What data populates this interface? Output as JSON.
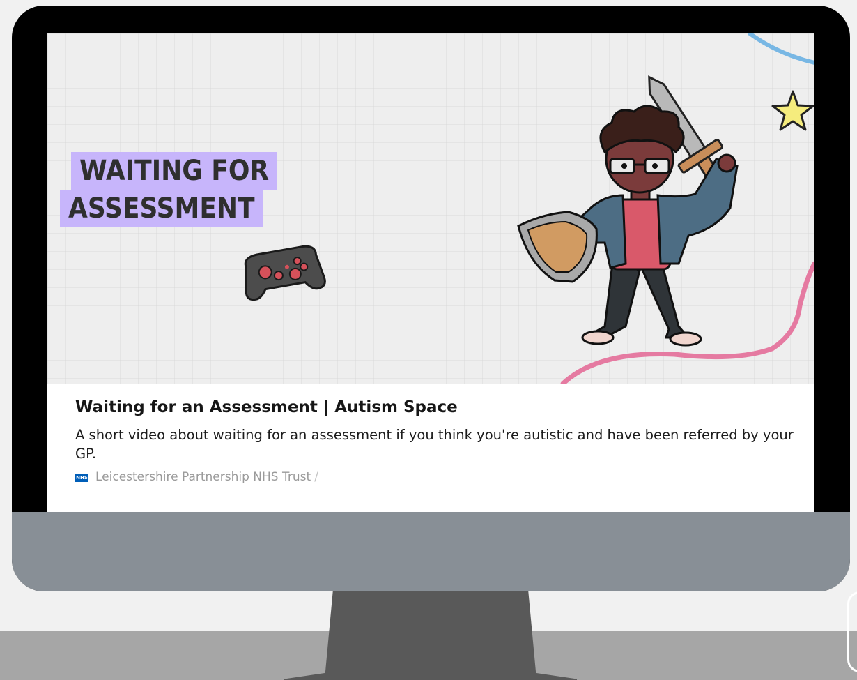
{
  "thumbnail": {
    "headline_line1": "WAITING FOR",
    "headline_line2": "ASSESSMENT",
    "highlight_color": "#c7b5fb",
    "illustration": [
      "gamepad-icon",
      "character-with-sword-and-shield",
      "star-icon"
    ]
  },
  "card": {
    "title": "Waiting for an Assessment | Autism Space",
    "description": "A short video about waiting for an assessment if you think you're autistic and have been referred by your GP.",
    "source_icon": "nhs-logo-icon",
    "source_icon_text": "NHS",
    "source": "Leicestershire Partnership NHS Trust",
    "source_separator": "/"
  },
  "colors": {
    "monitor_bezel": "#000000",
    "monitor_chin": "#888f96",
    "stand": "#595959",
    "floor": "#a6a6a6",
    "background": "#f1f1f1",
    "nhs_blue": "#005eb8"
  }
}
